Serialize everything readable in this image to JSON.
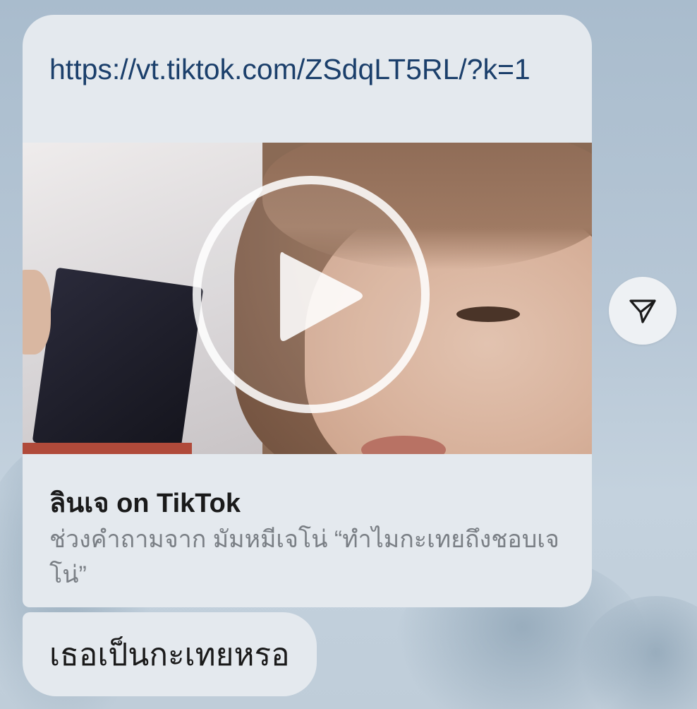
{
  "messages": {
    "link_message": {
      "url": "https://vt.tiktok.com/ZSdqLT5RL/?k=1",
      "preview": {
        "title": "ลินเจ on TikTok",
        "description": "ช่วงคำถามจาก มัมหมีเจโน่ “ทำไมกะเทยถึงชอบเจโน่”",
        "thumbnail": "video-thumbnail"
      }
    },
    "text_message": {
      "text": "เธอเป็นกะเทยหรอ"
    }
  },
  "icons": {
    "play": "play-icon",
    "share": "send-icon"
  },
  "colors": {
    "bubble_bg": "#e4e9ee",
    "link_color": "#1b3f6b",
    "desc_color": "#7a7f85"
  }
}
